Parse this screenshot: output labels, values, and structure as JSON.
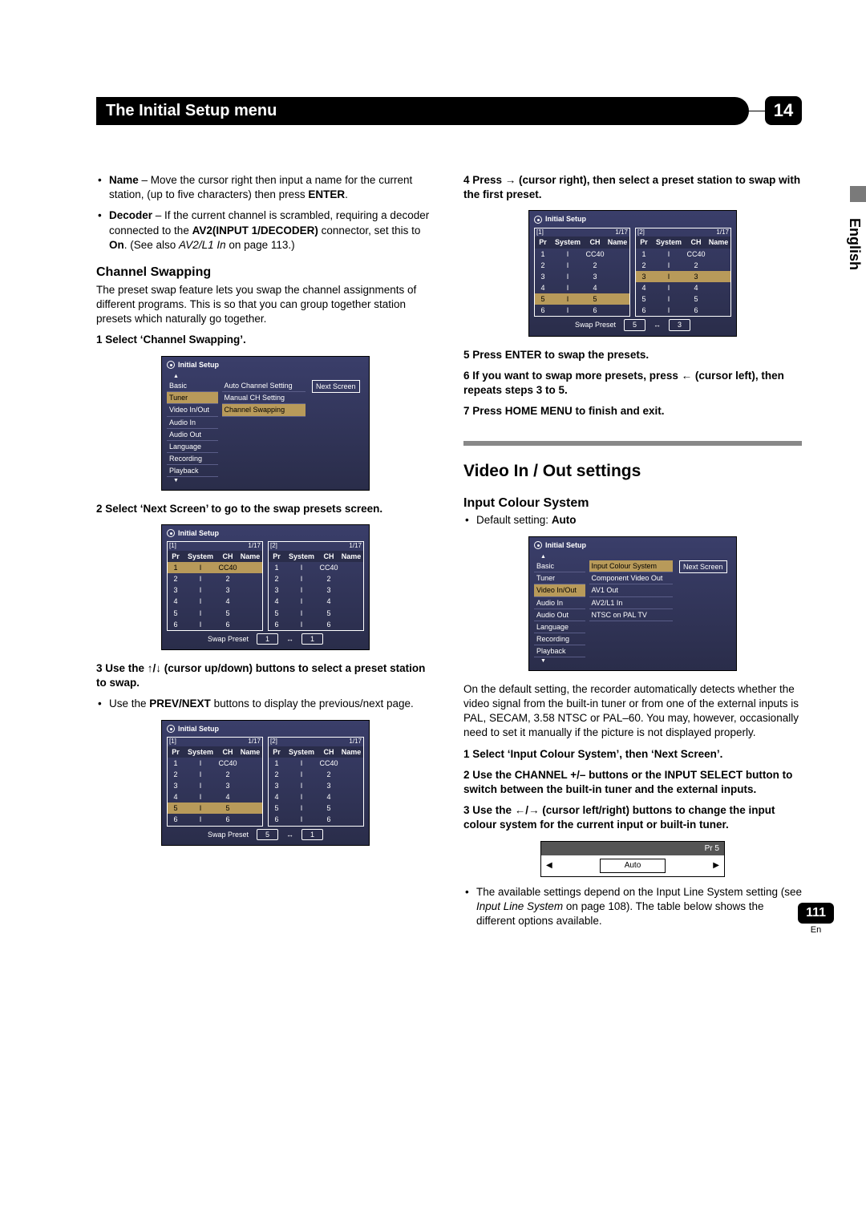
{
  "header": {
    "title": "The Initial Setup menu",
    "chapter": "14"
  },
  "sideTab": "English",
  "left": {
    "nameBullet_strong": "Name",
    "nameBullet_rest": " – Move the cursor right then input a name for the current station, (up to five characters) then press ",
    "nameBullet_key": "ENTER",
    "decoderBullet_strong": "Decoder",
    "decoderBullet_rest1": " – If the current channel is scrambled, requiring a decoder connected to the ",
    "decoderBullet_key1": "AV2(INPUT 1/DECODER)",
    "decoderBullet_rest2": " connector, set this to ",
    "decoderBullet_key2": "On",
    "decoderBullet_rest3": ". (See also ",
    "decoderBullet_em": "AV2/L1 In",
    "decoderBullet_rest4": " on page 113.)",
    "chSwapHead": "Channel Swapping",
    "chSwapPara": "The preset swap feature lets you swap the channel assignments of different programs. This is so that you can group together station presets which naturally go together.",
    "step1": "1    Select ‘Channel Swapping’.",
    "step2": "2    Select ‘Next Screen’ to go to the swap presets screen.",
    "step3a": "3    Use the ",
    "step3b": " (cursor up/down) buttons to select a preset station to swap.",
    "step3bullet_a": "Use the ",
    "step3bullet_key": "PREV/NEXT",
    "step3bullet_b": " buttons to display the previous/next page."
  },
  "right": {
    "step4a": "4    Press ",
    "step4b": " (cursor right), then select a preset station to swap with the first preset.",
    "step5": "5    Press ENTER to swap the presets.",
    "step6a": "6    If you want to swap more presets, press ",
    "step6b": " (cursor left), then repeats steps 3 to 5.",
    "step7": "7    Press HOME MENU to finish and exit.",
    "vioHead": "Video In / Out settings",
    "icsHead": "Input Colour System",
    "icsDefault_a": "Default setting: ",
    "icsDefault_b": "Auto",
    "icsPara": "On the default setting, the recorder automatically detects whether the video signal from the built-in tuner or from one of the external inputs is PAL, SECAM, 3.58 NTSC or PAL–60. You may, however, occasionally need to set it manually if the picture is not displayed properly.",
    "icsStep1": "1    Select ‘Input Colour System’, then ‘Next Screen’.",
    "icsStep2": "2    Use the CHANNEL +/– buttons or the INPUT SELECT button to switch between the built-in tuner and the external inputs.",
    "icsStep3a": "3    Use the ",
    "icsStep3b": " (cursor left/right) buttons to change the input colour system for the current input or built-in tuner.",
    "icsBullet_a": "The available settings depend on the Input Line System setting (see ",
    "icsBullet_em": "Input Line System",
    "icsBullet_b": " on page 108). The table below shows the different options available."
  },
  "osd": {
    "title": "Initial Setup",
    "menu": [
      "Basic",
      "Tuner",
      "Video In/Out",
      "Audio In",
      "Audio Out",
      "Language",
      "Recording",
      "Playback"
    ],
    "tunerSub": [
      "Auto Channel Setting",
      "Manual CH Setting",
      "Channel Swapping"
    ],
    "videoSub": [
      "Input Colour System",
      "Component Video Out",
      "AV1 Out",
      "AV2/L1 In",
      "NTSC on PAL TV"
    ],
    "next": "Next Screen",
    "tableHdr": [
      "Pr",
      "System",
      "CH",
      "Name"
    ],
    "pageInd": "1/17",
    "col1": "[1]",
    "col2": "[2]",
    "rows": [
      [
        "1",
        "I",
        "CC40",
        ""
      ],
      [
        "2",
        "I",
        "2",
        ""
      ],
      [
        "3",
        "I",
        "3",
        ""
      ],
      [
        "4",
        "I",
        "4",
        ""
      ],
      [
        "5",
        "I",
        "5",
        ""
      ],
      [
        "6",
        "I",
        "6",
        ""
      ]
    ],
    "swapLabel": "Swap Preset",
    "swapA1": "1",
    "swapB1": "1",
    "swapA2": "5",
    "swapB2": "1",
    "swapA3": "5",
    "swapB3": "3"
  },
  "autoBox": {
    "pr": "Pr 5",
    "val": "Auto"
  },
  "footer": {
    "page": "111",
    "lang": "En"
  }
}
